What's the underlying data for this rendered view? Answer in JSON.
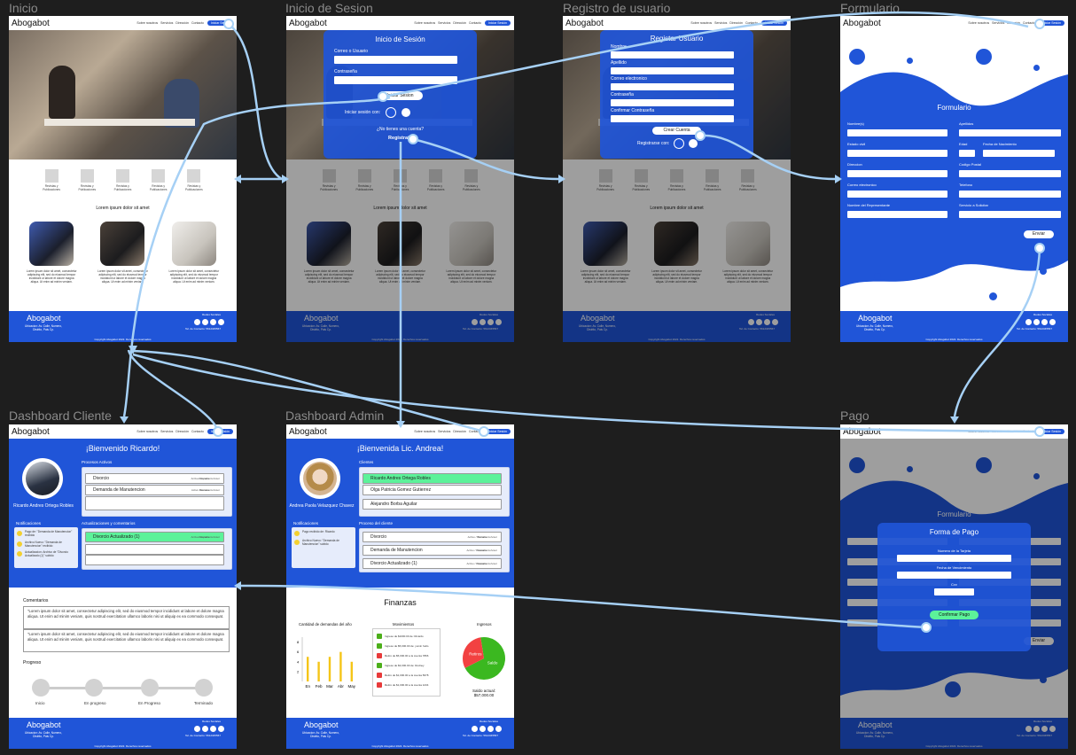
{
  "frames": {
    "inicio": "Inicio",
    "sesion": "Inicio de Sesion",
    "registro": "Registro de usuario",
    "formulario": "Formulario",
    "dash_cliente": "Dashboard Cliente",
    "dash_admin": "Dashboard Admin",
    "pago": "Pago"
  },
  "nav": {
    "logo": "Abogabot",
    "links": [
      "Sobre nosotros",
      "Servicios",
      "Dirección",
      "Contacto"
    ],
    "login_btn": "Iniciar Sesión"
  },
  "services": {
    "item_label": "Revistas y Publicaciones",
    "lorem_heading": "Lorem ipsum dolor sit amet",
    "card_text": "Lorem ipsum dolor sit amet, consectetur adipiscing elit, sed do eiusmod tempor incididunt ut labore et dolore magna aliqua. Ut enim ad minim veniam."
  },
  "footer": {
    "logo": "Abogabot",
    "address": "Ubicacion: Av. Calle, Numero, Distrito, Pais Cp.",
    "social": "Redes Sociales",
    "contact": "Tel. de Contacto: 5612345567",
    "copyright": "Copyright Abogabot 2022. Derechos reservados"
  },
  "login": {
    "title": "Inicio de Sesión",
    "user_label": "Correo o Usuario",
    "pass_label": "Contraseña",
    "submit": "Iniciar Sesion",
    "social_login": "Iniciar sesión con:",
    "no_account": "¿No tienes una cuenta?",
    "register": "Registrate"
  },
  "register": {
    "title": "Registar Usuario",
    "fields": [
      "Nombre",
      "Apellido",
      "Correo electronico",
      "Contraseña",
      "Confirmar Contraseña"
    ],
    "submit": "Crear Cuenta",
    "social": "Registrarse con:"
  },
  "form": {
    "title": "Formulario",
    "fields_left": [
      "Nombre(s)",
      "Estado civil",
      "Direccion",
      "Correo electronico",
      "Nombre del Representante"
    ],
    "fields_right": [
      "Apellidos",
      "Edad",
      "Fecha de Nacimiento",
      "Codigo Postal",
      "Telefono",
      "Servicio a Solicitar"
    ],
    "submit": "Enviar"
  },
  "cliente": {
    "welcome": "¡Bienvenido Ricardo!",
    "name": "Ricardo Andres Ortega Robles",
    "active_title": "Procesos Activos",
    "active": [
      {
        "name": "Divorcio",
        "status": "Activo/ocupado",
        "doc": "Documento/visor"
      },
      {
        "name": "Demanda de Manutencion",
        "status": "Activo Demaso",
        "doc": "Documento/visor"
      }
    ],
    "updates_title": "Actualizaciones y comentarios",
    "updates": [
      {
        "name": "Divorcio Actualizado (1)",
        "status": "Activo/ocupado",
        "doc": "Documento/visor"
      }
    ],
    "notif_title": "Notificaciones",
    "notifs": [
      "Pago de: \"Demanda de Manutencion\" recibido",
      "Archivo Nuevo: \"Demanda de Manutencion\" recibido",
      "Actualizacion: Archivo de \"Divorcio Actualizado (1)\" subido"
    ],
    "comments_title": "Comentarios",
    "comments": [
      "\"Lorem ipsum dolor sit amet, consectetur adipiscing elit, sed do eiusmod tempor incididunt ut labore et dolore magna aliqua. Ut enim ad minim veniam, quis nostrud exercitation ullamco laboris nisi ut aliquip ex ea commodo consequat.",
      "\"Lorem ipsum dolor sit amet, consectetur adipiscing elit, sed do eiusmod tempor incididunt ut labore et dolore magna aliqua. Ut enim ad minim veniam, quis nostrud exercitation ullamco laboris nisi ut aliquip ex ea commodo consequat."
    ],
    "progress_title": "Progreso",
    "steps": [
      "Inicio",
      "En progreso",
      "En Progreso",
      "Terminado"
    ]
  },
  "admin": {
    "welcome": "¡Bienvenida Lic. Andrea!",
    "name": "Andrea Paola Velazquez Chavez",
    "clients_title": "Clientes",
    "clients": [
      "Ricardo Andres Ortega Robles",
      "Olga Patricia Gomez Gutierrez",
      "Alejandro Borba Aguilar"
    ],
    "process_title": "Proceso del cliente",
    "processes": [
      {
        "name": "Divorcio",
        "status": "Activo / Borrado",
        "doc": "Documento/visor"
      },
      {
        "name": "Demanda de Manutencion",
        "status": "Activo / Pausado",
        "doc": "Documento/visor"
      },
      {
        "name": "Divorcio Actualizado (1)",
        "status": "Activo / Pausado",
        "doc": "Documento/visor"
      }
    ],
    "notif_title": "Notificaciones",
    "notifs": [
      "Pago recibido de: Ricardo",
      "Archivo Nuevo: \"Demanda de Manutencion\" subido"
    ],
    "finance_title": "Finanzas",
    "demands_title": "Cantidad de demandas del año",
    "moves_title": "Movimientos",
    "moves": [
      {
        "text": "Ingreso de $1000.00 de: Ricardo",
        "color": "#4caf1a"
      },
      {
        "text": "Ingreso de $5,000.00 de: yumin hello",
        "color": "#4caf1a"
      },
      {
        "text": "Retiro de $5,000.00 a la cuenta 7866",
        "color": "#e83a3a"
      },
      {
        "text": "Ingreso de $3,000.00 de: Rodney",
        "color": "#4caf1a"
      },
      {
        "text": "Retiro de $1,000.00 a la cuenta 5678",
        "color": "#e83a3a"
      },
      {
        "text": "Retiro de $1,000.00 a la cuenta 1234",
        "color": "#e83a3a"
      }
    ],
    "income_title": "Ingresos",
    "saldo": "Saldo",
    "retiros": "Retiros",
    "balance_label": "Saldo actual:",
    "balance": "$57,000.00"
  },
  "pago": {
    "title": "Forma de Pago",
    "fields": [
      "Numero de la Tarjeta",
      "Fecha de Vencimiento",
      "Cvv"
    ],
    "submit": "Confirmar Pago",
    "form_title": "Formulario",
    "enviar": "Enviar"
  },
  "chart_data": {
    "type": "bar",
    "title": "Cantidad de demandas del año",
    "categories": [
      "En",
      "Feb",
      "Mar",
      "Abr",
      "May"
    ],
    "values": [
      5,
      4,
      5,
      6,
      4
    ],
    "yticks": [
      2,
      4,
      6,
      8
    ],
    "ylim": [
      0,
      9
    ],
    "color": "#f5c518"
  },
  "pie_data": {
    "type": "pie",
    "title": "Ingresos",
    "slices": [
      {
        "name": "Saldo",
        "value": 70,
        "color": "#3bb820"
      },
      {
        "name": "Retiros",
        "value": 30,
        "color": "#f24141"
      }
    ]
  },
  "colors": {
    "brand": "#2055d8",
    "canvas": "#1e1e1e",
    "connector": "#a6d0f5",
    "highlight": "#5cf29a"
  }
}
